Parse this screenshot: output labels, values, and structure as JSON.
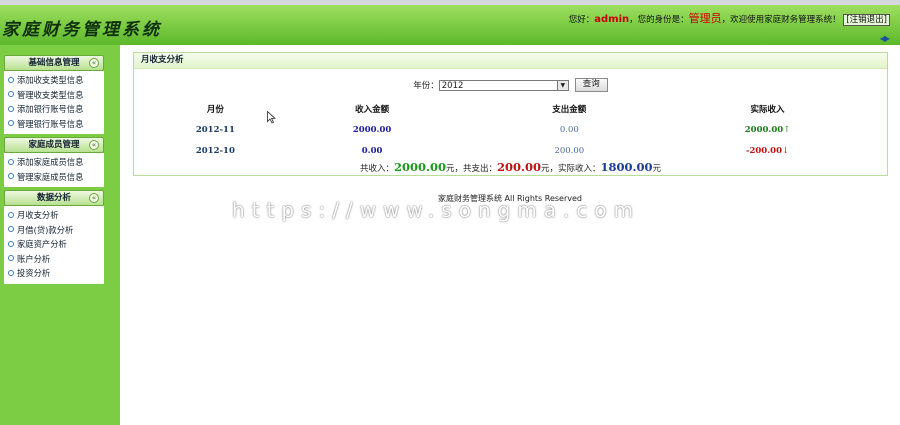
{
  "app": {
    "title": "家庭财务管理系统"
  },
  "header": {
    "welcome_prefix": "您好：",
    "username": "admin",
    "role_prefix": "，您的身份是：",
    "role": "管理员",
    "welcome_suffix": "，欢迎使用家庭财务管理系统！",
    "logout_label": "[注销退出]",
    "toggle_icon": "double-arrow-icon"
  },
  "sidebar": {
    "groups": [
      {
        "title": "基础信息管理",
        "items": [
          "添加收支类型信息",
          "管理收支类型信息",
          "添加银行账号信息",
          "管理银行账号信息"
        ]
      },
      {
        "title": "家庭成员管理",
        "items": [
          "添加家庭成员信息",
          "管理家庭成员信息"
        ]
      },
      {
        "title": "数据分析",
        "items": [
          "月收支分析",
          "月借(贷)款分析",
          "家庭资产分析",
          "账户分析",
          "投资分析"
        ]
      }
    ]
  },
  "panel": {
    "title": "月收支分析",
    "filter": {
      "year_label": "年份：",
      "year_value": "2012",
      "query_label": "查询"
    },
    "table": {
      "headers": [
        "月份",
        "收入金额",
        "支出金额",
        "实际收入"
      ],
      "rows": [
        {
          "month": "2012-11",
          "income": "2000.00",
          "expense": "0.00",
          "actual": "2000.00",
          "trend": "↑"
        },
        {
          "month": "2012-10",
          "income": "0.00",
          "expense": "200.00",
          "actual": "-200.00",
          "trend": "↓"
        }
      ]
    },
    "totals": {
      "income_label": "共收入：",
      "income_value": "2000.00",
      "expense_label": "元，共支出：",
      "expense_value": "200.00",
      "actual_label": "元，实际收入：",
      "actual_value": "1800.00",
      "unit": "元"
    }
  },
  "footer": {
    "text": "家庭财务管理系统 All Rights Reserved"
  },
  "watermark": {
    "text": "https://www.songma.com"
  },
  "colors": {
    "header_green": "#7ccc44",
    "sidebar_green": "#7ccc44",
    "income_green": "#1a9a1a",
    "expense_red": "#c01010",
    "actual_blue": "#1a3a9a"
  }
}
